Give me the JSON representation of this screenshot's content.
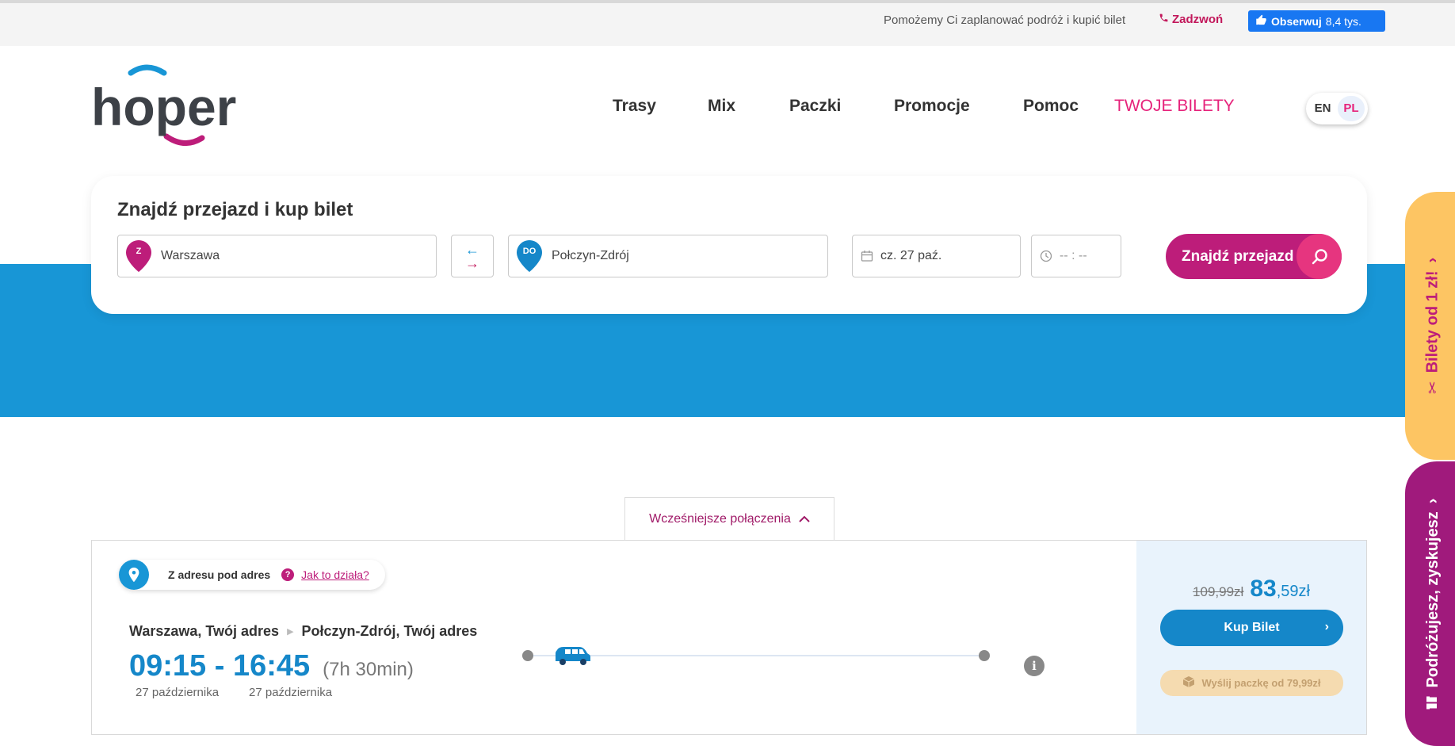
{
  "topbar": {
    "help_text": "Pomożemy Ci zaplanować podróż i kupić bilet",
    "call_label": "Zadzwoń",
    "fb_label": "Obserwuj",
    "fb_count": "8,4 tys."
  },
  "logo": {
    "text": "hoper"
  },
  "nav": {
    "items": [
      "Trasy",
      "Mix",
      "Paczki",
      "Promocje",
      "Pomoc"
    ],
    "tickets": "TWOJE BILETY"
  },
  "lang": {
    "en": "EN",
    "pl": "PL"
  },
  "search": {
    "title": "Znajdź przejazd i kup bilet",
    "from_marker": "Z",
    "from_value": "Warszawa",
    "to_marker": "DO",
    "to_value": "Połczyn-Zdrój",
    "date_value": "cz. 27 paź.",
    "time_value": "-- : --",
    "button_label": "Znajdź przejazd"
  },
  "earlier": {
    "label": "Wcześniejsze połączenia"
  },
  "result": {
    "badge_text": "Z adresu pod adres",
    "how_link": "Jak to działa?",
    "from": "Warszawa, Twój adres",
    "to": "Połczyn-Zdrój, Twój adres",
    "times": "09:15 - 16:45",
    "duration": "(7h 30min)",
    "dep_date": "27 października",
    "arr_date": "27 października",
    "old_price": "109,99zł",
    "new_price_int": "83",
    "new_price_dec": ",59zł",
    "buy_label": "Kup Bilet",
    "parcel_label": "Wyślij paczkę od 79,99zł"
  },
  "side_tabs": {
    "promo": "Bilety od 1 zł!",
    "travel": "Podróżujesz, zyskujesz"
  },
  "colors": {
    "brand_pink": "#bd1d7a",
    "brand_blue": "#1896d6",
    "accent_yellow": "#fdc563",
    "accent_purple": "#a01a7c"
  }
}
